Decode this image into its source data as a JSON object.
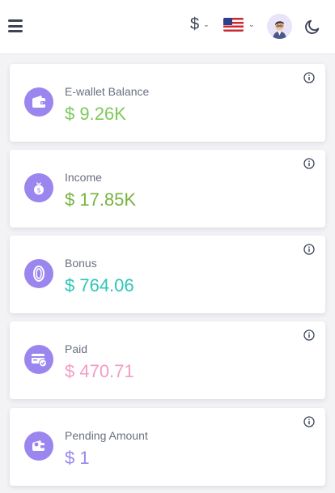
{
  "header": {
    "currency_symbol": "$",
    "menu_icon": "hamburger-icon",
    "flag_icon": "us-flag-icon",
    "theme_icon": "moon-icon"
  },
  "cards": [
    {
      "label": "E-wallet Balance",
      "value": "$ 9.26K",
      "color": "#7dc95a",
      "icon": "wallet-icon"
    },
    {
      "label": "Income",
      "value": "$ 17.85K",
      "color": "#78b33f",
      "icon": "money-bag-icon"
    },
    {
      "label": "Bonus",
      "value": "$ 764.06",
      "color": "#2fc6b7",
      "icon": "coin-icon"
    },
    {
      "label": "Paid",
      "value": "$ 470.71",
      "color": "#f39cc4",
      "icon": "card-check-icon"
    },
    {
      "label": "Pending Amount",
      "value": "$ 1",
      "color": "#9b86ef",
      "icon": "pending-wallet-icon"
    }
  ]
}
